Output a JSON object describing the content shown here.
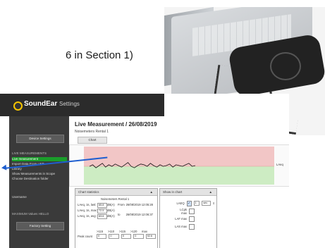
{
  "section_text": "6 in Section 1)",
  "app": {
    "logo_brand": "SoundEar",
    "logo_suffix": "Settings",
    "title": "Live Measurement / 26/08/2019",
    "subtitle": "Noisemeters Rental 1",
    "tab_chart": "Chart",
    "chart_value_label": "LAeq",
    "sidebar": {
      "top_button": "Device Settings",
      "section_heading": "LIVE MEASUREMENTS",
      "items": [
        "Live measurement",
        "Import Data From USB",
        "Library",
        "Show Measurements in Scope",
        "Choose Destination folder"
      ],
      "middle_item": "Username",
      "bottom_heading": "MAXIMUM Values HELLO",
      "bottom_button": "Factory Setting"
    },
    "chart_statistics": {
      "header": "Chart statistics",
      "device": "Noisemeters Rental 1",
      "rows": [
        {
          "label": "LAeq, 1s, last:",
          "value": "65.8",
          "unit": "dB(A)"
        },
        {
          "label": "LAeq, 1s, max:",
          "value": "72.5",
          "unit": "dB(A)"
        },
        {
          "label": "LAeq, 1s, avg:",
          "value": "63.6",
          "unit": "dB(A)"
        }
      ],
      "from_label": "From",
      "from_value": "26/08/2019 12:05:28",
      "to_label": "to",
      "to_value": "26/08/2019 12:06:37",
      "peak_label": "Peak count",
      "peak_headers": [
        ">115",
        ">110",
        ">115",
        ">120",
        "max"
      ],
      "peak_values": [
        "0",
        "0",
        "0",
        "0",
        "92.6"
      ]
    },
    "show_in_chart": {
      "header": "Show in chart",
      "items": [
        {
          "label": "LAEQ",
          "checked": true,
          "value": "1",
          "unit": "sec"
        },
        {
          "label": "LCpk max",
          "checked": false
        },
        {
          "label": "LAF max",
          "checked": false
        },
        {
          "label": "LAS max",
          "checked": false
        }
      ]
    }
  },
  "chart_data": {
    "type": "line",
    "series": [
      {
        "name": "LAeq",
        "values": [
          64,
          66,
          62,
          65,
          68,
          63,
          66,
          64,
          67,
          65,
          63,
          66,
          69,
          64,
          62,
          65,
          67,
          66,
          64,
          68,
          65,
          63,
          66,
          64,
          65,
          67,
          63,
          66,
          65,
          64,
          66,
          68,
          64,
          65
        ]
      }
    ],
    "ylim": [
      40,
      90
    ]
  },
  "colors": {
    "accent": "#1a9e2a",
    "arrow": "#1f5fd0",
    "chart_red": "#f2c6c6",
    "chart_green": "#cdecc3"
  }
}
